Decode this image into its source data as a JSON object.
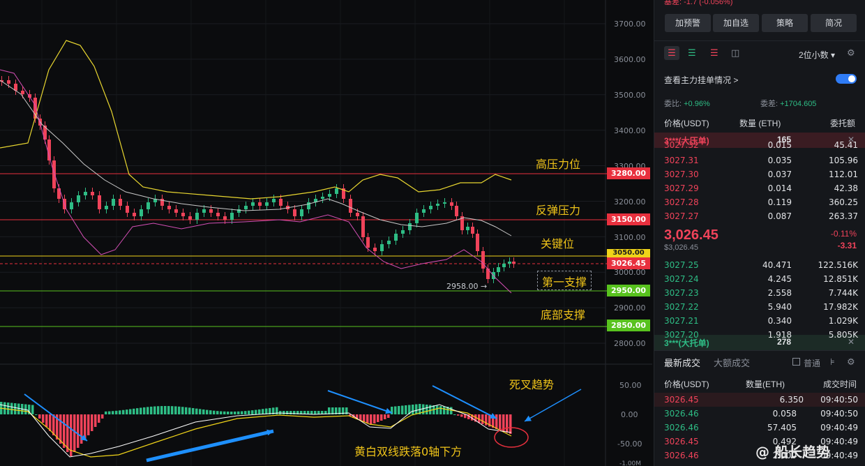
{
  "chart": {
    "price_axis": [
      "3700.00",
      "3600.00",
      "3500.00",
      "3400.00",
      "3300.00",
      "3200.00",
      "3100.00",
      "3000.00",
      "2900.00",
      "2800.00"
    ],
    "macd_axis": [
      "50.00",
      "0.00",
      "-50.00"
    ],
    "macd_axis_bottom": "-1.00M",
    "levels": {
      "l3280": "3280.00",
      "l3150": "3150.00",
      "l3050": "3050.00",
      "current": "3026.45",
      "l2950": "2950.00",
      "l2850": "2850.00"
    },
    "low_marker": "2958.00 →",
    "annotations": {
      "high_pressure": "高压力位",
      "rebound_pressure": "反弹压力",
      "key_level": "关键位",
      "first_support": "第一支撑",
      "bottom_support": "底部支撑",
      "death_cross": "死叉趋势",
      "macd_note": "黄白双线跌落0轴下方"
    },
    "watermark": "@ 船长趋势",
    "colors": {
      "up": "#2ebd85",
      "down": "#f0435a",
      "boll_upper": "#e8d630",
      "boll_mid": "#c9c9c9",
      "boll_lower": "#d44fb5"
    }
  },
  "panel": {
    "top_text": "基差: -1.7 (-0.056%)",
    "buttons": [
      "加预警",
      "加自选",
      "策略",
      "简况"
    ],
    "precision": "2位小数",
    "main_orders_label": "查看主力挂单情况 >",
    "ratio_label": "委比:",
    "ratio_value": "+0.96%",
    "diff_label": "委差:",
    "diff_value": "+1704.605",
    "cols": {
      "price": "价格(USDT)",
      "qty": "数量 (ETH)",
      "total": "委托额"
    },
    "ask_banner": {
      "label": "3***(大压单)",
      "qty": "165"
    },
    "asks": [
      {
        "price": "3027.32",
        "qty": "0.015",
        "total": "45.41"
      },
      {
        "price": "3027.31",
        "qty": "0.035",
        "total": "105.96"
      },
      {
        "price": "3027.30",
        "qty": "0.037",
        "total": "112.01"
      },
      {
        "price": "3027.29",
        "qty": "0.014",
        "total": "42.38"
      },
      {
        "price": "3027.28",
        "qty": "0.119",
        "total": "360.25"
      },
      {
        "price": "3027.27",
        "qty": "0.087",
        "total": "263.37"
      }
    ],
    "last_price": "3,026.45",
    "last_price_sub": "$3,026.45",
    "change_pct": "-0.11%",
    "change_abs": "-3.31",
    "bids": [
      {
        "price": "3027.25",
        "qty": "40.471",
        "total": "122.516K"
      },
      {
        "price": "3027.24",
        "qty": "4.245",
        "total": "12.851K"
      },
      {
        "price": "3027.23",
        "qty": "2.558",
        "total": "7.744K"
      },
      {
        "price": "3027.22",
        "qty": "5.940",
        "total": "17.982K"
      },
      {
        "price": "3027.21",
        "qty": "0.340",
        "total": "1.029K"
      },
      {
        "price": "3027.20",
        "qty": "1.918",
        "total": "5.805K"
      }
    ],
    "bid_banner": {
      "label": "3***(大托单)",
      "qty": "278"
    },
    "trades_tab_active": "最新成交",
    "trades_tab": "大额成交",
    "normal_label": "普通",
    "trade_cols": {
      "price": "价格(USDT)",
      "qty": "数量(ETH)",
      "time": "成交时间"
    },
    "trades": [
      {
        "price": "3026.45",
        "qty": "6.350",
        "time": "09:40:50",
        "side": "red"
      },
      {
        "price": "3026.46",
        "qty": "0.058",
        "time": "09:40:50",
        "side": "green"
      },
      {
        "price": "3026.46",
        "qty": "57.405",
        "time": "09:40:49",
        "side": "green"
      },
      {
        "price": "3026.45",
        "qty": "0.492",
        "time": "09:40:49",
        "side": "red"
      },
      {
        "price": "3026.46",
        "qty": "2.000",
        "time": "09:40:49",
        "side": "red"
      }
    ]
  }
}
